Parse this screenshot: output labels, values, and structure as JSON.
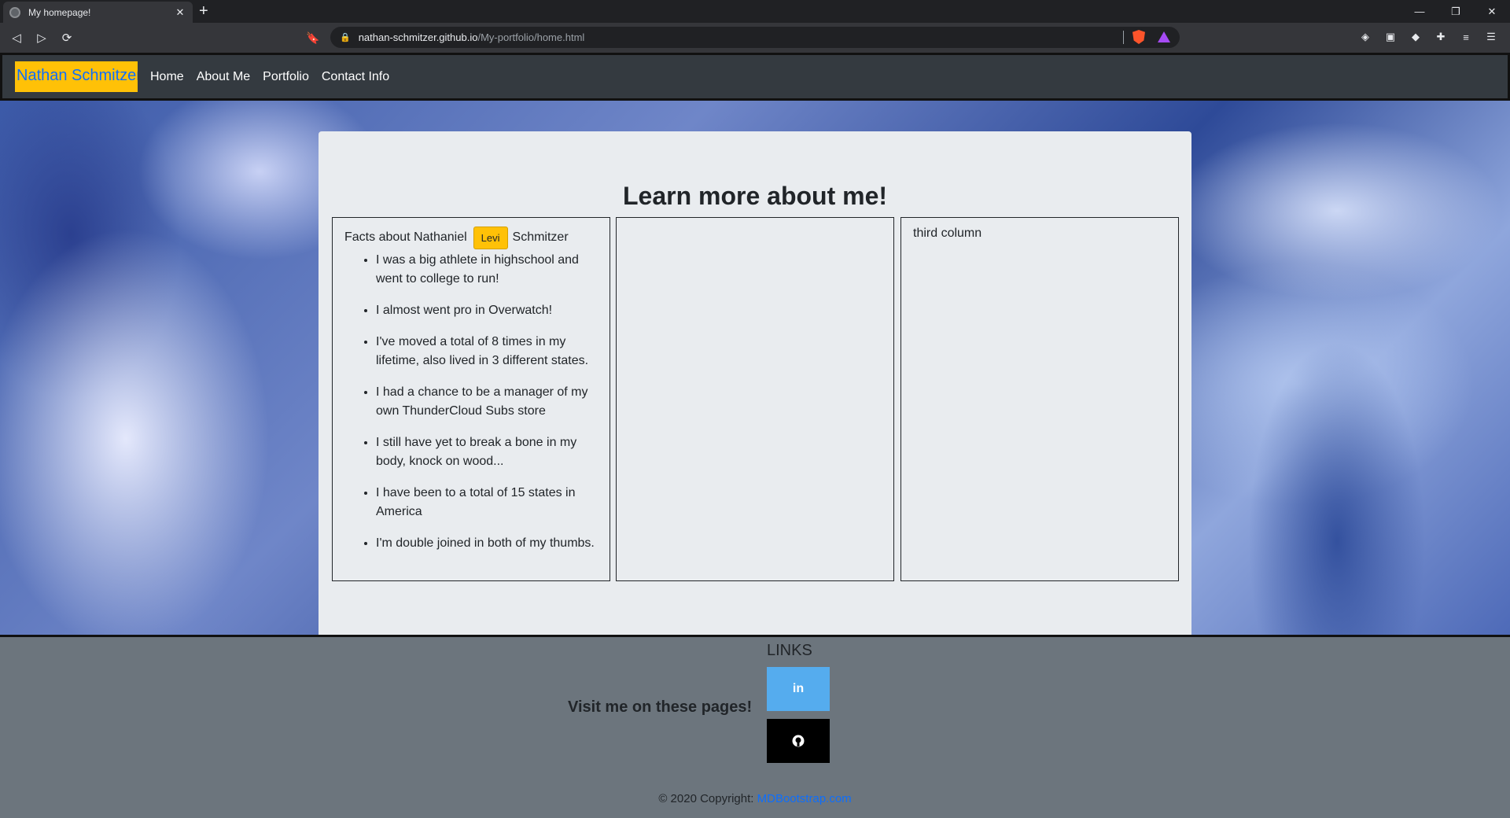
{
  "browser": {
    "tab_title": "My homepage!",
    "tab_close": "✕",
    "new_tab": "+",
    "url_host": "nathan-schmitzer.github.io",
    "url_path": "/My-portfolio/home.html",
    "window_controls": {
      "minimize": "—",
      "restore": "❐",
      "close": "✕"
    }
  },
  "navbar": {
    "brand": "Nathan Schmitzer",
    "links": [
      "Home",
      "About Me",
      "Portfolio",
      "Contact Info"
    ]
  },
  "main": {
    "title": "Learn more about me!",
    "column1": {
      "heading_before": "Facts about Nathaniel",
      "badge": "Levi",
      "heading_after": "Schmitzer",
      "facts": [
        "I was a big athlete in highschool and went to college to run!",
        "I almost went pro in Overwatch!",
        "I've moved a total of 8 times in my lifetime, also lived in 3 different states.",
        "I had a chance to be a manager of my own ThunderCloud Subs store",
        "I still have yet to break a bone in my body, knock on wood...",
        "I have been to a total of 15 states in America",
        "I'm double joined in both of my thumbs."
      ]
    },
    "column3": {
      "text": "third column"
    }
  },
  "footer": {
    "links_heading": "LINKS",
    "visit_text": "Visit me on these pages!",
    "linkedin_label": "in",
    "copyright_prefix": "© 2020 Copyright: ",
    "copyright_link": "MDBootstrap.com"
  },
  "colors": {
    "brand_bg": "#ffc107",
    "brand_text": "#0d6efd",
    "navbar_bg": "#343a40",
    "card_bg": "#e9ecef",
    "footer_bg": "#6c757d",
    "linkedin": "#55acee",
    "github": "#000000"
  }
}
